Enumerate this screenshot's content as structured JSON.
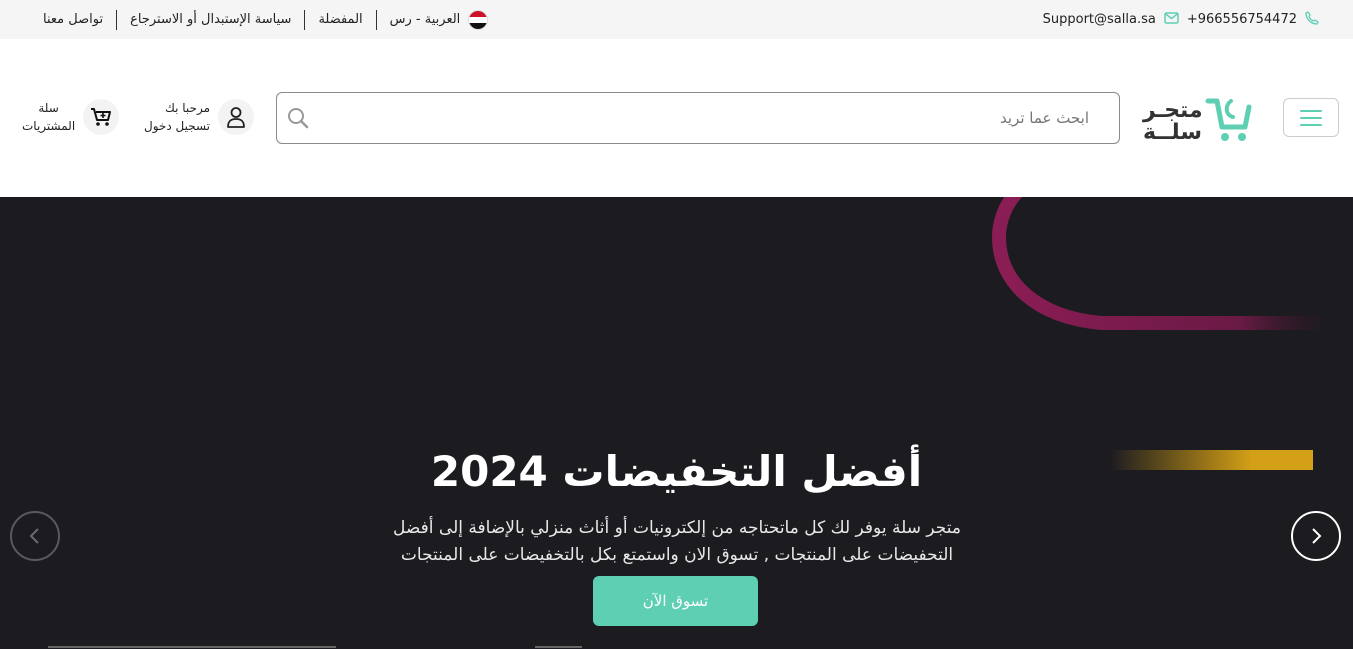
{
  "topbar": {
    "contact_us": "تواصل معنا",
    "return_policy": "سياسة الإستبدال أو الاسترجاع",
    "favorites": "المفضلة",
    "language": "العربية - رس",
    "email": "Support@salla.sa",
    "phone": "+966556754472",
    "icons": [
      "email-icon",
      "phone-icon",
      "egypt-flag-icon"
    ]
  },
  "header": {
    "logo_line1": "متجـر",
    "logo_line2": "سلــة",
    "search_placeholder": "ابحث عما تريد",
    "account_greeting": "مرحبا بك",
    "account_login": "تسجيل دخول",
    "cart_line1": "سلة",
    "cart_line2": "المشتريات",
    "icons": [
      "menu-icon",
      "cart-logo-icon",
      "search-icon",
      "user-icon",
      "cart-icon"
    ]
  },
  "hero": {
    "title": "أفضل التخفيضات 2024",
    "subtitle_line1": "متجر سلة يوفر لك كل ماتحتاجه من إلكترونيات أو أثاث منزلي بالإضافة إلى أفضل",
    "subtitle_line2": "التحفيضات على المنتجات , تسوق الان واستمتع بكل بالتخفيضات على المنتجات",
    "cta_label": "تسوق الآن",
    "icons": [
      "chevron-left-icon",
      "chevron-right-icon"
    ]
  },
  "colors": {
    "accent": "#5fcfb4",
    "hero_bg": "#1c1b20",
    "arc": "#8b1d55",
    "gold": "#d4a015"
  }
}
